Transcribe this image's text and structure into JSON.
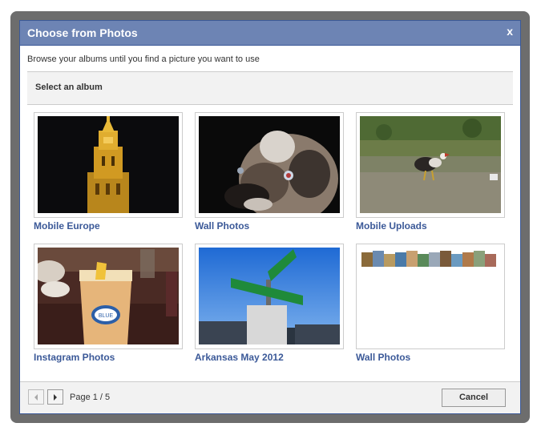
{
  "dialog": {
    "title": "Choose from Photos",
    "close_label": "x",
    "subtitle": "Browse your albums until you find a picture you want to use",
    "section_header": "Select an album"
  },
  "albums": [
    {
      "label": "Mobile Europe",
      "image": "night bell tower"
    },
    {
      "label": "Wall Photos",
      "image": "dog face close-up"
    },
    {
      "label": "Mobile Uploads",
      "image": "rooster on grass"
    },
    {
      "label": "Instagram Photos",
      "image": "glass of beer"
    },
    {
      "label": "Arkansas May 2012",
      "image": "street signs against blue sky"
    },
    {
      "label": "Wall Photos",
      "image": "panorama collage strip"
    }
  ],
  "pagination": {
    "text": "Page 1 / 5",
    "current": 1,
    "total": 5
  },
  "footer": {
    "cancel_label": "Cancel"
  },
  "colors": {
    "titlebar": "#6d84b4",
    "link": "#3b5998",
    "frame": "#6d6d6d"
  }
}
